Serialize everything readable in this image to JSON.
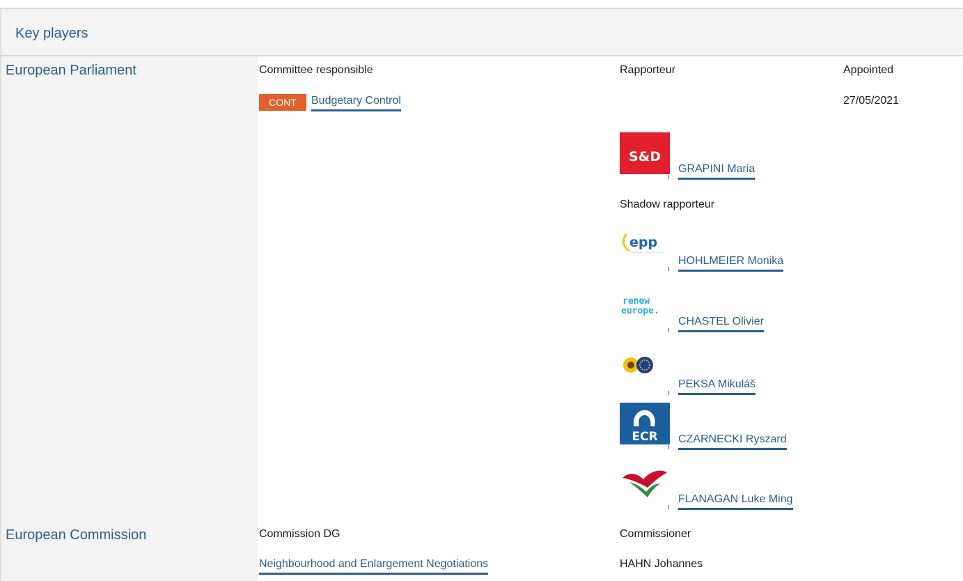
{
  "header": {
    "title": "Key players"
  },
  "parliament": {
    "label": "European Parliament",
    "committee_header": "Committee responsible",
    "rapporteur_header": "Rapporteur",
    "appointed_header": "Appointed",
    "committee_code": "CONT",
    "committee_name": "Budgetary Control",
    "appointed_date": "27/05/2021",
    "rapporteur": {
      "name": "GRAPINI Maria",
      "group_logo_text": "S&D",
      "group_icon": "sd-group-logo-icon"
    },
    "shadow_header": "Shadow rapporteur",
    "shadows": [
      {
        "name": "HOHLMEIER Monika",
        "group_logo_text": "epp",
        "group_icon": "epp-group-logo-icon"
      },
      {
        "name": "CHASTEL Olivier",
        "group_logo_text": "renew europe.",
        "group_icon": "renew-group-logo-icon"
      },
      {
        "name": "PEKSA Mikuláš",
        "group_logo_text": "",
        "group_icon": "greens-group-logo-icon"
      },
      {
        "name": "CZARNECKI Ryszard",
        "group_logo_text": "ECR",
        "group_icon": "ecr-group-logo-icon"
      },
      {
        "name": "FLANAGAN Luke Ming",
        "group_logo_text": "",
        "group_icon": "left-group-logo-icon"
      }
    ]
  },
  "commission": {
    "label": "European Commission",
    "dg_header": "Commission DG",
    "commissioner_header": "Commissioner",
    "dg_name": "Neighbourhood and Enlargement Negotiations",
    "commissioner_name": "HAHN Johannes"
  },
  "colors": {
    "link": "#2a5f8f",
    "badge": "#e0612c",
    "sd_red": "#e31f2d",
    "ecr_blue": "#1b5f9e",
    "left_red": "#c8102e",
    "left_green": "#2e8b3a"
  }
}
